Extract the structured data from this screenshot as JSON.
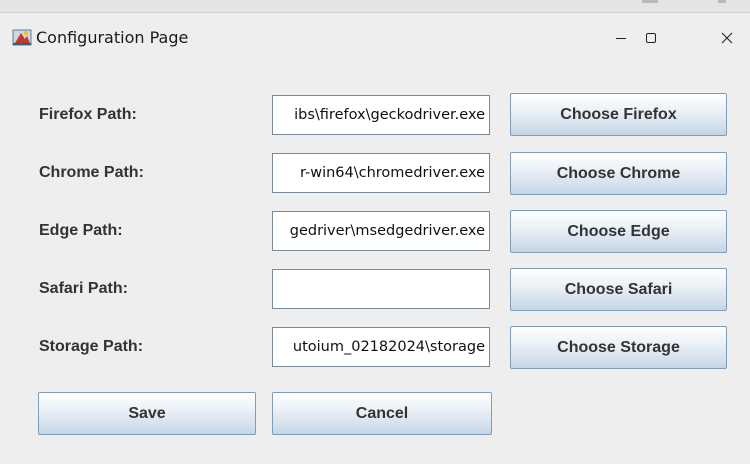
{
  "window": {
    "title": "Configuration Page",
    "controls": {
      "minimize": "–",
      "maximize": "□",
      "close": "✕"
    }
  },
  "form": {
    "rows": [
      {
        "label": "Firefox Path:",
        "value": "ibs\\firefox\\geckodriver.exe",
        "button": "Choose Firefox"
      },
      {
        "label": "Chrome Path:",
        "value": "r-win64\\chromedriver.exe",
        "button": "Choose Chrome"
      },
      {
        "label": "Edge Path:",
        "value": "gedriver\\msedgedriver.exe",
        "button": "Choose Edge"
      },
      {
        "label": "Safari Path:",
        "value": "",
        "button": "Choose Safari"
      },
      {
        "label": "Storage Path:",
        "value": "utoium_02182024\\storage",
        "button": "Choose Storage"
      }
    ]
  },
  "actions": {
    "save": "Save",
    "cancel": "Cancel"
  }
}
